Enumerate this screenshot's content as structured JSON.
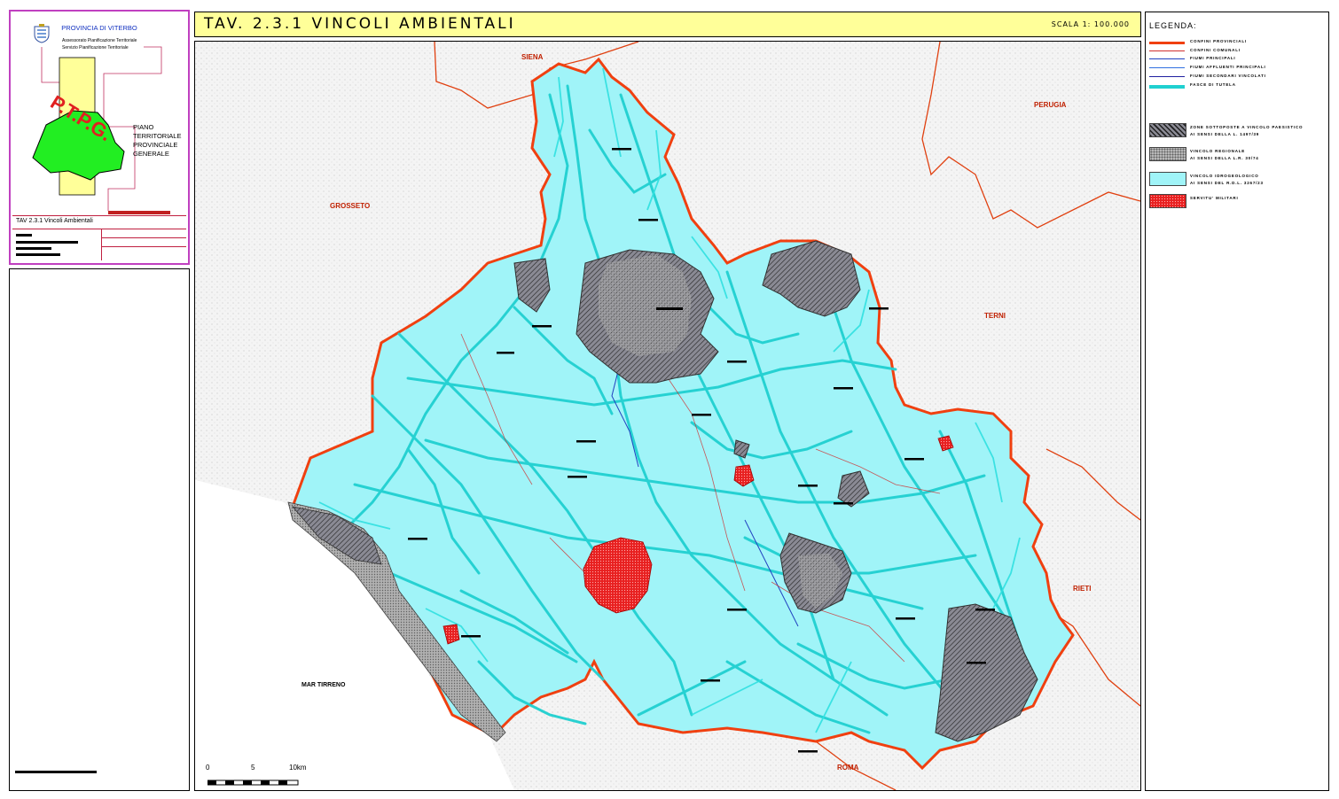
{
  "header": {
    "title": "TAV. 2.3.1 VINCOLI AMBIENTALI",
    "scale": "SCALA 1: 100.000"
  },
  "cartouche": {
    "org": "PROVINCIA DI VITERBO",
    "dept1": "Assessorato Pianificazione Territoriale",
    "dept2": "Servizio Pianificazione Territoriale",
    "ptpg_letters": "P.T.P.G.",
    "plan_name": "PIANO\nTERRITORIALE\nPROVINCIALE\nGENERALE",
    "sheet": "TAV 2.3.1 Vincoli Ambientali"
  },
  "legend": {
    "title": "LEGENDA:",
    "lines": [
      {
        "label": "CONFINI PROVINCIALI",
        "color": "#f04010"
      },
      {
        "label": "CONFINI COMUNALI",
        "color": "#d03030"
      },
      {
        "label": "FIUMI PRINCIPALI",
        "color": "#2040c0"
      },
      {
        "label": "FIUMI AFFLUENTI PRINCIPALI",
        "color": "#3070e0"
      },
      {
        "label": "FIUMI SECONDARI VINCOLATI",
        "color": "#2020a0"
      },
      {
        "label": "FASCE DI TUTELA",
        "color": "#20d0d0"
      }
    ],
    "areas": [
      {
        "label": "ZONE SOTTOPOSTE A VINCOLO PAESISTICO\nAI SENSI DELLA L. 1497/39",
        "fill": "#505060"
      },
      {
        "label": "VINCOLO REGIONALE\nAI SENSI DELLA L.R. 30/74",
        "fill": "#a0a0a0"
      },
      {
        "label": "VINCOLO IDROGEOLOGICO\nAI SENSI DEL R.D.L. 3267/23",
        "fill": "#a0f4f8"
      },
      {
        "label": "SERVITU' MILITARI",
        "fill": "#e02020"
      }
    ]
  },
  "map": {
    "places": [
      {
        "name": "SIENA"
      },
      {
        "name": "PERUGIA"
      },
      {
        "name": "GROSSETO"
      },
      {
        "name": "TERNI"
      },
      {
        "name": "RIETI"
      },
      {
        "name": "ROMA"
      }
    ],
    "sea": "MAR TIRRENO",
    "colors": {
      "province_border": "#f04010",
      "idro": "#a0f4f8",
      "rivers": "#20d0d0",
      "land": "#e8e8e8"
    }
  },
  "scalebar": {
    "ticks": [
      "0",
      "5",
      "10km"
    ]
  }
}
